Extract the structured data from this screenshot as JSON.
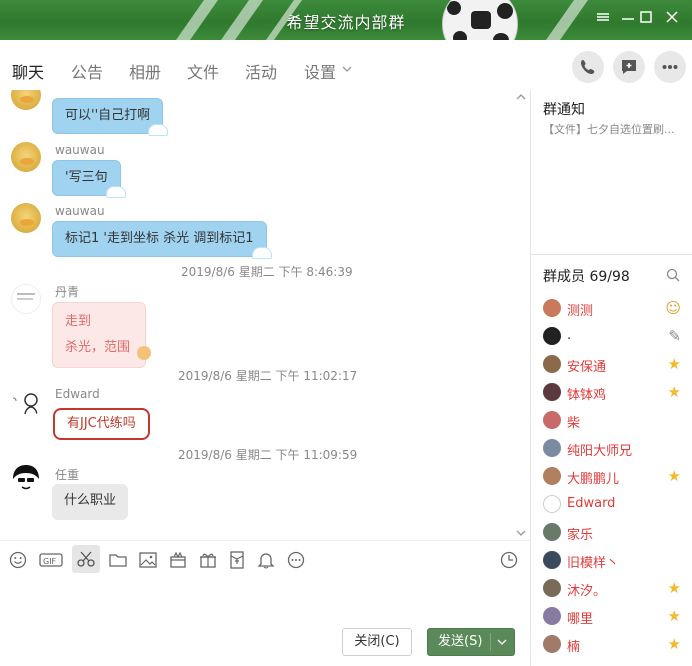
{
  "window": {
    "title": "希望交流内部群",
    "controls": [
      "menu",
      "minimize",
      "maximize",
      "close"
    ]
  },
  "tabs": [
    {
      "label": "聊天",
      "active": true
    },
    {
      "label": "公告",
      "active": false
    },
    {
      "label": "相册",
      "active": false
    },
    {
      "label": "文件",
      "active": false
    },
    {
      "label": "活动",
      "active": false
    },
    {
      "label": "设置",
      "active": false
    }
  ],
  "header_actions": [
    "phone-icon",
    "add-chat-icon",
    "more-icon"
  ],
  "messages": {
    "m1": {
      "text": "可以''自己打啊"
    },
    "m2": {
      "sender": "wauwau",
      "text": "'写三句"
    },
    "m3": {
      "sender": "wauwau",
      "text": "标记1  '走到坐标 杀光   调到标记1"
    },
    "t1": "2019/8/6 星期二 下午 8:46:39",
    "m4": {
      "sender": "丹青",
      "line1": "走到",
      "line2": "杀光，范围"
    },
    "t2": "2019/8/6 星期二 下午 11:02:17",
    "m5": {
      "sender": "Edward",
      "text": "有JJC代练吗"
    },
    "t3": "2019/8/6 星期二 下午 11:09:59",
    "m6": {
      "sender": "任重",
      "text": "什么职业"
    }
  },
  "toolbar": {
    "icons": [
      "emoji-icon",
      "gif-icon",
      "scissors-icon",
      "folder-icon",
      "image-icon",
      "gift-box-icon",
      "gift-icon",
      "red-packet-icon",
      "bell-icon",
      "more-dots-icon",
      "history-clock-icon"
    ]
  },
  "buttons": {
    "close_label": "关闭(C)",
    "send_label": "发送(S)"
  },
  "notice": {
    "title": "群通知",
    "text": "【文件】七夕自选位置刷..."
  },
  "members": {
    "title": "群成员 69/98",
    "list": [
      {
        "name": "测测",
        "color": "#e03a3a",
        "badge": "person"
      },
      {
        "name": ".",
        "color": "#333333",
        "badge": "edit"
      },
      {
        "name": "安保通",
        "color": "#e03a3a",
        "badge": "star"
      },
      {
        "name": "钵钵鸡",
        "color": "#e03a3a",
        "badge": "star"
      },
      {
        "name": "柴",
        "color": "#e03a3a",
        "badge": ""
      },
      {
        "name": "纯阳大师兄",
        "color": "#e03a3a",
        "badge": ""
      },
      {
        "name": "大鹏鹏儿",
        "color": "#e03a3a",
        "badge": "star"
      },
      {
        "name": "Edward",
        "color": "#e03a3a",
        "badge": ""
      },
      {
        "name": "家乐",
        "color": "#e03a3a",
        "badge": ""
      },
      {
        "name": "旧模样丶",
        "color": "#e03a3a",
        "badge": ""
      },
      {
        "name": "沐汐。",
        "color": "#e03a3a",
        "badge": "star"
      },
      {
        "name": "哪里",
        "color": "#e03a3a",
        "badge": "star"
      },
      {
        "name": "楠",
        "color": "#e03a3a",
        "badge": "star"
      }
    ]
  }
}
